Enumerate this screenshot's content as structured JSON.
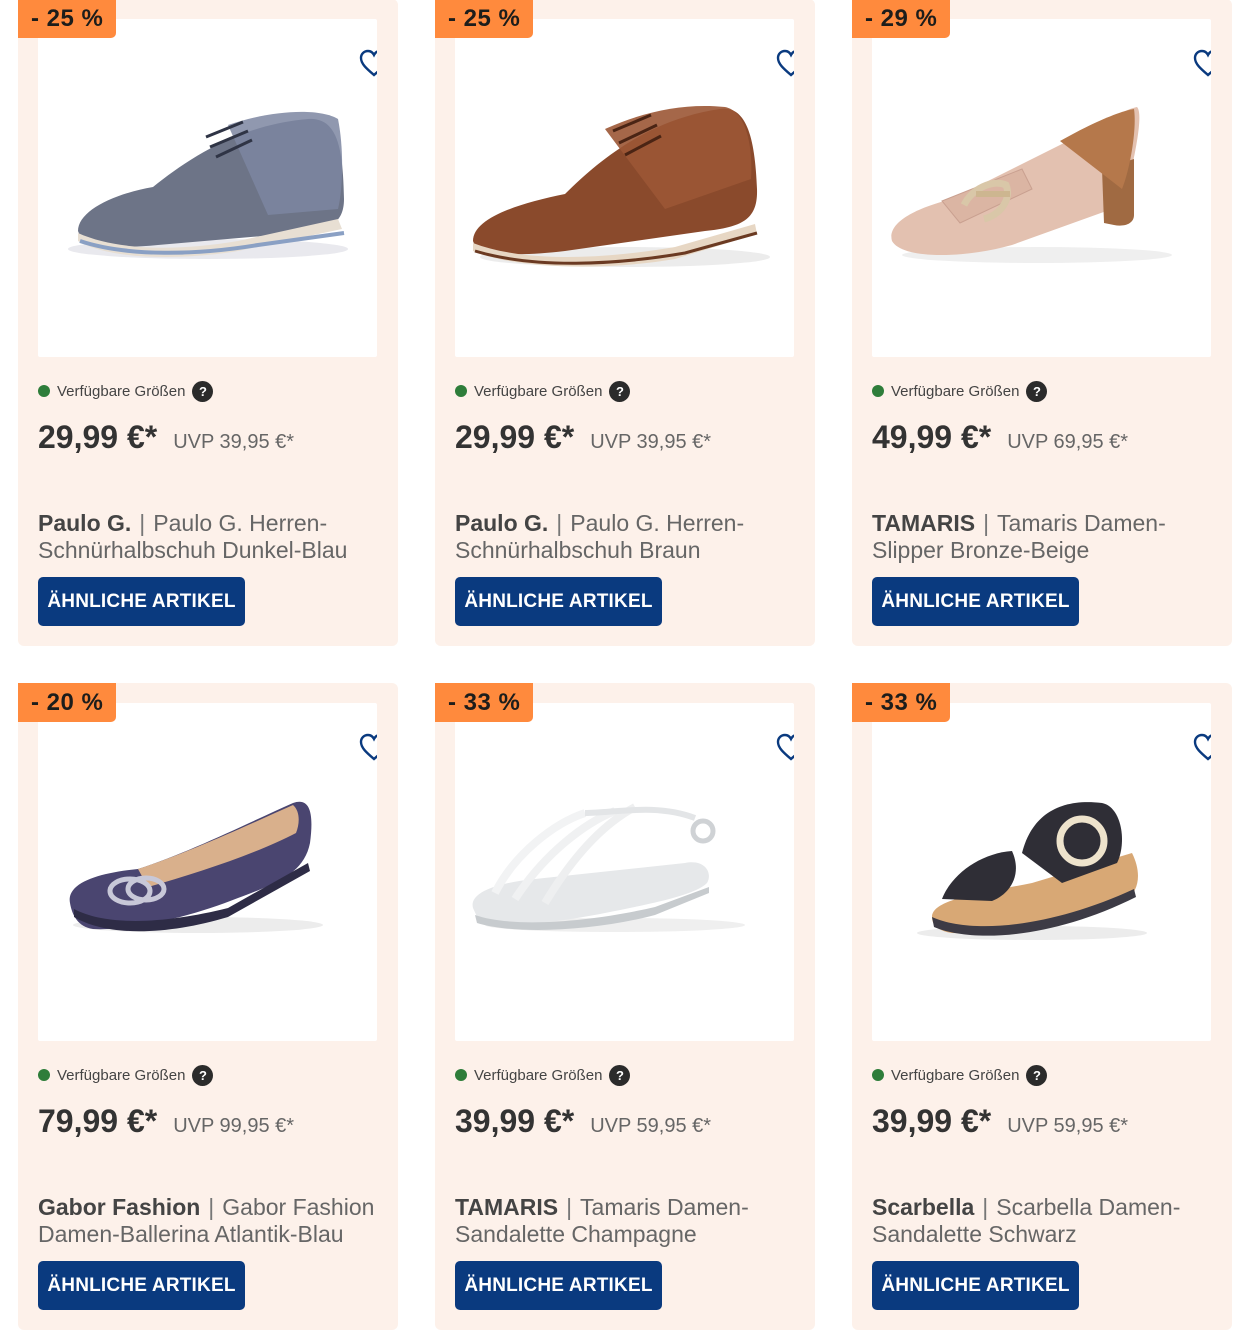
{
  "labels": {
    "sizes": "Verfügbare Größen",
    "help": "?",
    "button": "ÄHNLICHE ARTIKEL",
    "separator": "|"
  },
  "colors": {
    "card_bg": "#fdf1ea",
    "badge": "#ff8a3d",
    "button": "#0a3a7f",
    "availability_dot": "#2e7d3a"
  },
  "products": [
    {
      "discount": "- 25 %",
      "price": "29,99 €*",
      "uvp": "UVP 39,95 €*",
      "brand": "Paulo G.",
      "name": "Paulo G. Herren-Schnürhalbschuh Dunkel-Blau",
      "image_icon": "oxford-shoe-blue"
    },
    {
      "discount": "- 25 %",
      "price": "29,99 €*",
      "uvp": "UVP 39,95 €*",
      "brand": "Paulo G.",
      "name": "Paulo G. Herren-Schnürhalbschuh Braun",
      "image_icon": "oxford-shoe-brown"
    },
    {
      "discount": "- 29 %",
      "price": "49,99 €*",
      "uvp": "UVP 69,95 €*",
      "brand": "TAMARIS",
      "name": "Tamaris Damen-Slipper Bronze-Beige",
      "image_icon": "loafer-beige"
    },
    {
      "discount": "- 20 %",
      "price": "79,99 €*",
      "uvp": "UVP 99,95 €*",
      "brand": "Gabor Fashion",
      "name": "Gabor Fashion Damen-Ballerina Atlantik-Blau",
      "image_icon": "ballerina-navy"
    },
    {
      "discount": "- 33 %",
      "price": "39,99 €*",
      "uvp": "UVP 59,95 €*",
      "brand": "TAMARIS",
      "name": "Tamaris Damen-Sandalette Champagne",
      "image_icon": "sandal-white"
    },
    {
      "discount": "- 33 %",
      "price": "39,99 €*",
      "uvp": "UVP 59,95 €*",
      "brand": "Scarbella",
      "name": "Scarbella Damen-Sandalette Schwarz",
      "image_icon": "wedge-sandal-black"
    }
  ]
}
